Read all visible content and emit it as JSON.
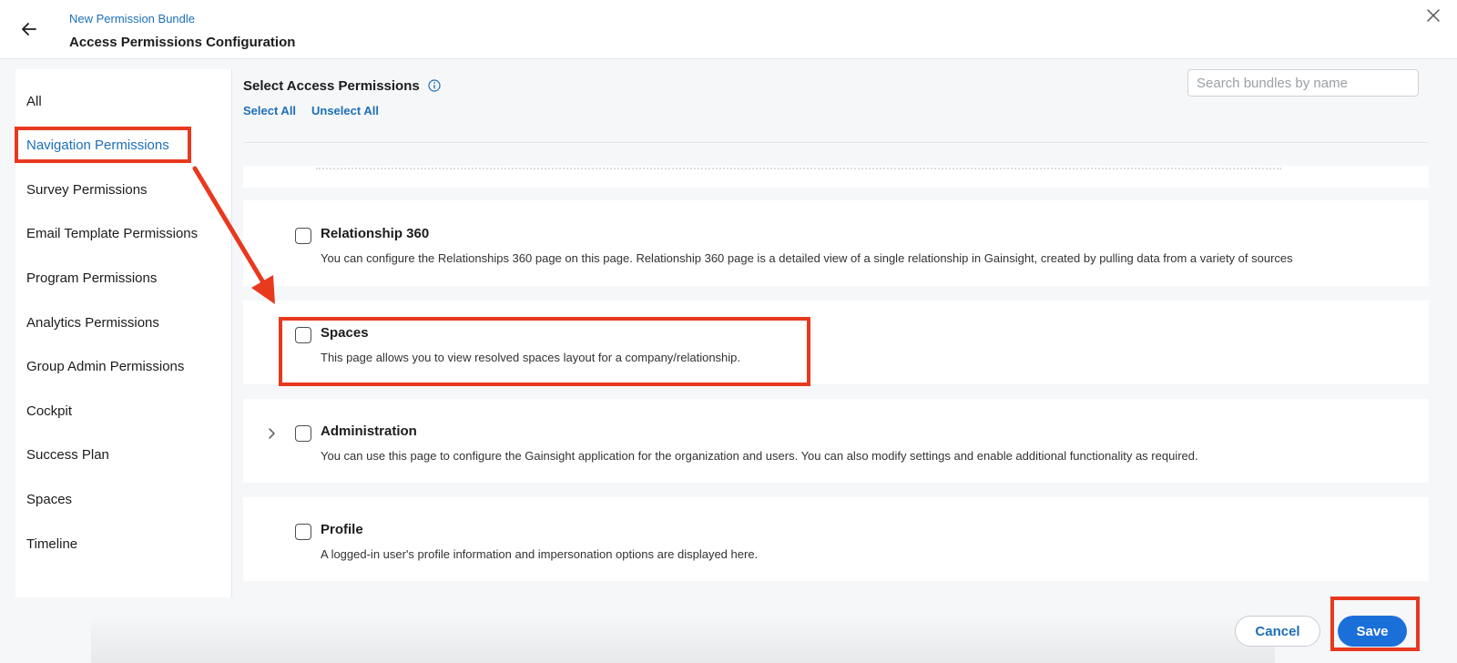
{
  "header": {
    "breadcrumb": "New Permission Bundle",
    "title": "Access Permissions Configuration"
  },
  "sidebar": {
    "items": [
      {
        "label": "All"
      },
      {
        "label": "Navigation Permissions",
        "active": true
      },
      {
        "label": "Survey Permissions"
      },
      {
        "label": "Email Template Permissions"
      },
      {
        "label": "Program Permissions"
      },
      {
        "label": "Analytics Permissions"
      },
      {
        "label": "Group Admin Permissions"
      },
      {
        "label": "Cockpit"
      },
      {
        "label": "Success Plan"
      },
      {
        "label": "Spaces"
      },
      {
        "label": "Timeline"
      }
    ]
  },
  "main": {
    "section_title": "Select Access Permissions",
    "select_all": "Select All",
    "unselect_all": "Unselect All",
    "search_placeholder": "Search bundles by name",
    "permissions": [
      {
        "title": "Relationship 360",
        "description": "You can configure the Relationships 360 page on this page. Relationship 360 page is a detailed view of a single relationship in Gainsight, created by pulling data from a variety of sources",
        "checked": false
      },
      {
        "title": "Spaces",
        "description": "This page allows you to view resolved spaces layout for a company/relationship.",
        "checked": false
      },
      {
        "title": "Administration",
        "description": "You can use this page to configure the Gainsight application for the organization and users. You can also modify settings and enable additional functionality as required.",
        "checked": false,
        "expandable": true
      },
      {
        "title": "Profile",
        "description": "A logged-in user's profile information and impersonation options are displayed here.",
        "checked": false
      }
    ]
  },
  "footer": {
    "cancel_label": "Cancel",
    "save_label": "Save"
  },
  "colors": {
    "accent": "#1d6fb8",
    "primary_button": "#1b6fd9",
    "annotation": "#e8391f"
  },
  "icons": [
    "arrow-left-icon",
    "close-icon",
    "info-icon",
    "chevron-right-icon"
  ]
}
